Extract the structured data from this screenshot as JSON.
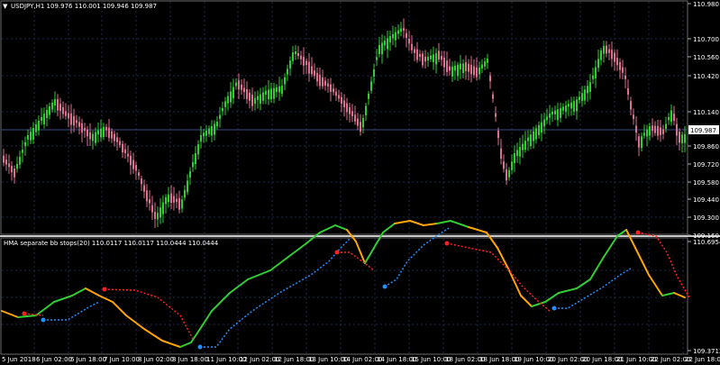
{
  "window": {
    "title": "USDJPY,H1  109.976 110.001 109.946 109.987",
    "symbol_icon": "triangle-down-icon"
  },
  "price_axis": {
    "ticks": [
      "110.980",
      "110.700",
      "110.560",
      "110.420",
      "110.140",
      "109.987",
      "109.860",
      "109.720",
      "109.580",
      "109.440",
      "109.300",
      "109.160"
    ],
    "current_price": "109.987"
  },
  "indicator": {
    "title": "HMA separate bb stops(20) 110.0117 110.0117 110.0444 110.0444",
    "ticks": [
      "110.6954",
      "109.3712"
    ]
  },
  "time_axis": {
    "labels": [
      "5 Jun 2018",
      "6 Jun 02:00",
      "6 Jun 18:00",
      "7 Jun 10:00",
      "8 Jun 02:00",
      "8 Jun 18:00",
      "11 Jun 10:00",
      "12 Jun 02:00",
      "12 Jun 18:00",
      "13 Jun 10:00",
      "14 Jun 02:00",
      "14 Jun 18:00",
      "15 Jun 10:00",
      "18 Jun 02:00",
      "18 Jun 18:00",
      "19 Jun 10:00",
      "20 Jun 02:00",
      "20 Jun 18:00",
      "21 Jun 10:00",
      "22 Jun 02:00",
      "22 Jun 18:00"
    ]
  },
  "colors": {
    "background": "#000000",
    "bull": "#32cd32",
    "bear": "#db7093",
    "grid": "#1c2a48",
    "current_line": "#3a4a8a",
    "hma_up": "#32cd32",
    "hma_down": "#ffa500",
    "stop_down": "#ff2020",
    "stop_up": "#1e90ff"
  }
}
